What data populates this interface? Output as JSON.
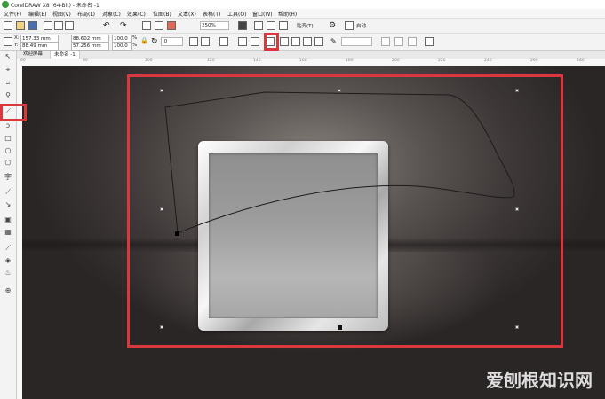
{
  "app": {
    "title": "CorelDRAW X8 (64-Bit) - 未命名 -1"
  },
  "menu": [
    "文件(F)",
    "编辑(E)",
    "视图(V)",
    "布局(L)",
    "对象(C)",
    "效果(C)",
    "位图(B)",
    "文本(X)",
    "表格(T)",
    "工具(O)",
    "窗口(W)",
    "帮助(H)"
  ],
  "toolbar": {
    "zoom": "250%",
    "snap": "贴齐(T)",
    "launch": "启动"
  },
  "property_bar": {
    "x_label": "X:",
    "x_value": "157.33 mm",
    "y_label": "Y:",
    "y_value": "88.49 mm",
    "w_value": "88.602 mm",
    "h_value": "57.256 mm",
    "scale_w": "100.0",
    "scale_h": "100.0",
    "pct": "%",
    "rotation": ".0"
  },
  "tabs": [
    "欢迎屏幕",
    "未命名 -1"
  ],
  "ruler_ticks": [
    "60",
    "80",
    "100",
    "120",
    "140",
    "160",
    "180",
    "200",
    "220",
    "240",
    "260",
    "280"
  ],
  "watermark": "爱刨根知识网",
  "colors": {
    "highlight": "#d9393c",
    "canvas_dark": "#2a2625"
  }
}
